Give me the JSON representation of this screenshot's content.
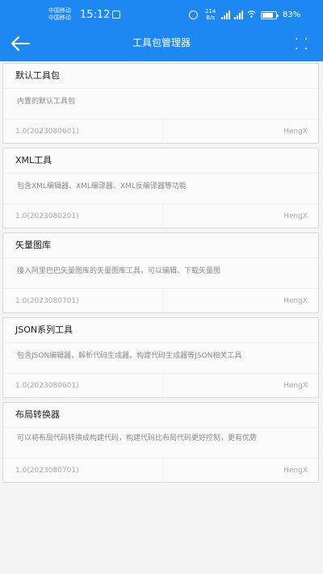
{
  "status_bar": {
    "carrier_1": "中国移动",
    "carrier_2": "中国移动",
    "time": "15:12",
    "net_speed_value": "214",
    "net_speed_unit": "B/s",
    "battery_level": 83,
    "battery_text": "83%"
  },
  "app_bar": {
    "title": "工具包管理器"
  },
  "packages": [
    {
      "name": "默认工具包",
      "description": "内置的默认工具包",
      "version": "1.0(2023080601)",
      "author": "HengX"
    },
    {
      "name": "XML工具",
      "description": "包含XML编辑器、XML编译器、XML反编译器等功能",
      "version": "1.0(2023080201)",
      "author": "HengX"
    },
    {
      "name": "矢量图库",
      "description": "接入阿里巴巴矢量图库的矢量图库工具，可以编辑、下载矢量图",
      "version": "1.0(2023080701)",
      "author": "HengX"
    },
    {
      "name": "JSON系列工具",
      "description": "包含JSON编辑器、解析代码生成器、构建代码生成器等JSON相关工具",
      "version": "1.0(2023080601)",
      "author": "HengX"
    },
    {
      "name": "布局转换器",
      "description": "可以将布局代码转换成构建代码，构建代码比布局代码更好控制，更有优势",
      "version": "1.0(2023080701)",
      "author": "HengX"
    }
  ],
  "colors": {
    "accent": "#1e88f2",
    "background": "#f4f4f4",
    "card": "#fafafa"
  }
}
